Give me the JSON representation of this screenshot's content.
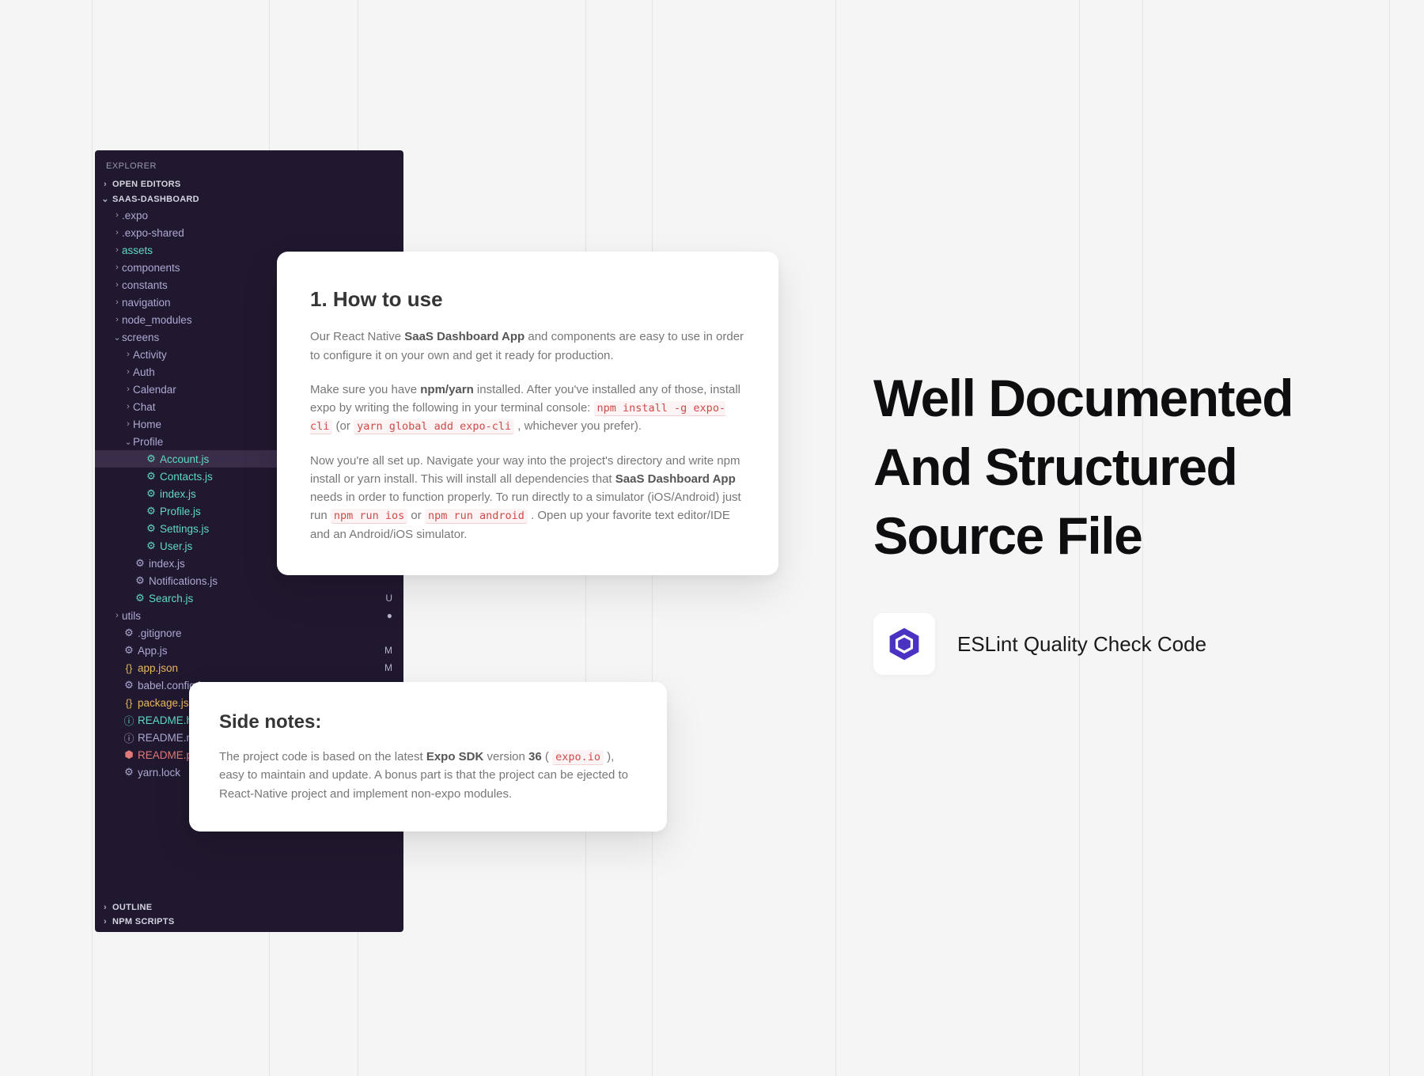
{
  "bg_grid_cols": [
    116,
    340,
    452,
    740,
    824,
    1056,
    1364,
    1444,
    1756
  ],
  "explorer": {
    "title": "EXPLORER",
    "sections_top": [
      {
        "label": "OPEN EDITORS",
        "expanded": false
      },
      {
        "label": "SAAS-DASHBOARD",
        "expanded": true
      }
    ],
    "tree": [
      {
        "depth": 1,
        "type": "folder",
        "expanded": false,
        "label": ".expo",
        "color": "purple",
        "icon": "",
        "file": false
      },
      {
        "depth": 1,
        "type": "folder",
        "expanded": false,
        "label": ".expo-shared",
        "color": "purple",
        "icon": "",
        "file": false
      },
      {
        "depth": 1,
        "type": "folder",
        "expanded": false,
        "label": "assets",
        "color": "teal",
        "icon": "",
        "file": false
      },
      {
        "depth": 1,
        "type": "folder",
        "expanded": false,
        "label": "components",
        "color": "purple",
        "icon": "",
        "file": false
      },
      {
        "depth": 1,
        "type": "folder",
        "expanded": false,
        "label": "constants",
        "color": "purple",
        "icon": "",
        "file": false
      },
      {
        "depth": 1,
        "type": "folder",
        "expanded": false,
        "label": "navigation",
        "color": "purple",
        "icon": "",
        "file": false
      },
      {
        "depth": 1,
        "type": "folder",
        "expanded": false,
        "label": "node_modules",
        "color": "purple",
        "icon": "",
        "file": false
      },
      {
        "depth": 1,
        "type": "folder",
        "expanded": true,
        "label": "screens",
        "color": "purple",
        "icon": "",
        "file": false
      },
      {
        "depth": 2,
        "type": "folder",
        "expanded": false,
        "label": "Activity",
        "color": "purple",
        "icon": "",
        "file": false
      },
      {
        "depth": 2,
        "type": "folder",
        "expanded": false,
        "label": "Auth",
        "color": "purple",
        "icon": "",
        "file": false
      },
      {
        "depth": 2,
        "type": "folder",
        "expanded": false,
        "label": "Calendar",
        "color": "purple",
        "icon": "",
        "file": false
      },
      {
        "depth": 2,
        "type": "folder",
        "expanded": false,
        "label": "Chat",
        "color": "purple",
        "icon": "",
        "file": false
      },
      {
        "depth": 2,
        "type": "folder",
        "expanded": false,
        "label": "Home",
        "color": "purple",
        "icon": "",
        "file": false
      },
      {
        "depth": 2,
        "type": "folder",
        "expanded": true,
        "label": "Profile",
        "color": "purple",
        "icon": "",
        "file": false
      },
      {
        "depth": 3,
        "type": "file",
        "label": "Account.js",
        "color": "teal",
        "icon": "⚙",
        "file": true,
        "highlight": true
      },
      {
        "depth": 3,
        "type": "file",
        "label": "Contacts.js",
        "color": "teal",
        "icon": "⚙",
        "file": true
      },
      {
        "depth": 3,
        "type": "file",
        "label": "index.js",
        "color": "teal",
        "icon": "⚙",
        "file": true
      },
      {
        "depth": 3,
        "type": "file",
        "label": "Profile.js",
        "color": "teal",
        "icon": "⚙",
        "file": true
      },
      {
        "depth": 3,
        "type": "file",
        "label": "Settings.js",
        "color": "teal",
        "icon": "⚙",
        "file": true
      },
      {
        "depth": 3,
        "type": "file",
        "label": "User.js",
        "color": "teal",
        "icon": "⚙",
        "file": true
      },
      {
        "depth": 2,
        "type": "file",
        "label": "index.js",
        "color": "purple",
        "icon": "⚙",
        "file": true
      },
      {
        "depth": 2,
        "type": "file",
        "label": "Notifications.js",
        "color": "purple",
        "icon": "⚙",
        "file": true
      },
      {
        "depth": 2,
        "type": "file",
        "label": "Search.js",
        "color": "teal",
        "icon": "⚙",
        "file": true,
        "badge": "U"
      },
      {
        "depth": 1,
        "type": "folder",
        "expanded": false,
        "label": "utils",
        "color": "purple",
        "icon": "",
        "file": false,
        "badge": "●"
      },
      {
        "depth": 1,
        "type": "file",
        "label": ".gitignore",
        "color": "purple",
        "icon": "⚙",
        "file": true
      },
      {
        "depth": 1,
        "type": "file",
        "label": "App.js",
        "color": "purple",
        "icon": "⚙",
        "file": true,
        "badge": "M"
      },
      {
        "depth": 1,
        "type": "file",
        "label": "app.json",
        "color": "orange",
        "icon": "{}",
        "file": true,
        "badge": "M"
      },
      {
        "depth": 1,
        "type": "file",
        "label": "babel.config.js",
        "color": "purple",
        "icon": "⚙",
        "file": true
      },
      {
        "depth": 1,
        "type": "file",
        "label": "package.json",
        "color": "orange",
        "icon": "{}",
        "file": true
      },
      {
        "depth": 1,
        "type": "file",
        "label": "README.html",
        "color": "teal",
        "icon": "ⓘ",
        "file": true
      },
      {
        "depth": 1,
        "type": "file",
        "label": "README.md",
        "color": "purple",
        "icon": "ⓘ",
        "file": true
      },
      {
        "depth": 1,
        "type": "file",
        "label": "README.pdf",
        "color": "red",
        "icon": "⬢",
        "file": true
      },
      {
        "depth": 1,
        "type": "file",
        "label": "yarn.lock",
        "color": "purple",
        "icon": "⚙",
        "file": true
      }
    ],
    "sections_bottom": [
      {
        "label": "OUTLINE"
      },
      {
        "label": "NPM SCRIPTS"
      }
    ]
  },
  "doc1": {
    "heading": "1. How to use",
    "p1_a": "Our React Native ",
    "p1_strong": "SaaS Dashboard App",
    "p1_b": " and components are easy to use in order to configure it on your own and get it ready for production.",
    "p2_a": "Make sure you have ",
    "p2_strong": "npm/yarn",
    "p2_b": " installed. After you've installed any of those, install expo by writing the following in your terminal console: ",
    "p2_code1": "npm install -g expo-cli",
    "p2_c": " (or ",
    "p2_code2": "yarn global add expo-cli",
    "p2_d": " , whichever you prefer).",
    "p3_a": "Now you're all set up. Navigate your way into the project's directory and write npm install or yarn install. This will install all dependencies that ",
    "p3_strong": "SaaS Dashboard App",
    "p3_b": " needs in order to function properly. To run directly to a simulator (iOS/Android) just run ",
    "p3_code1": "npm run ios",
    "p3_c": " or ",
    "p3_code2": "npm run android",
    "p3_d": " . Open up your favorite text editor/IDE and an Android/iOS simulator."
  },
  "doc2": {
    "heading": "Side notes:",
    "p1_a": "The project code is based on the latest ",
    "p1_strong1": "Expo SDK",
    "p1_b": " version ",
    "p1_strong2": "36",
    "p1_c": " ( ",
    "p1_code": "expo.io",
    "p1_d": " ), easy to maintain and update. A bonus part is that the project can be ejected to React-Native project and implement non-expo modules."
  },
  "right": {
    "heading_l1": "Well Documented",
    "heading_l2": "And Structured",
    "heading_l3": "Source File",
    "eslint_label": "ESLint Quality Check Code",
    "eslint_icon_color": "#4b32c3"
  }
}
